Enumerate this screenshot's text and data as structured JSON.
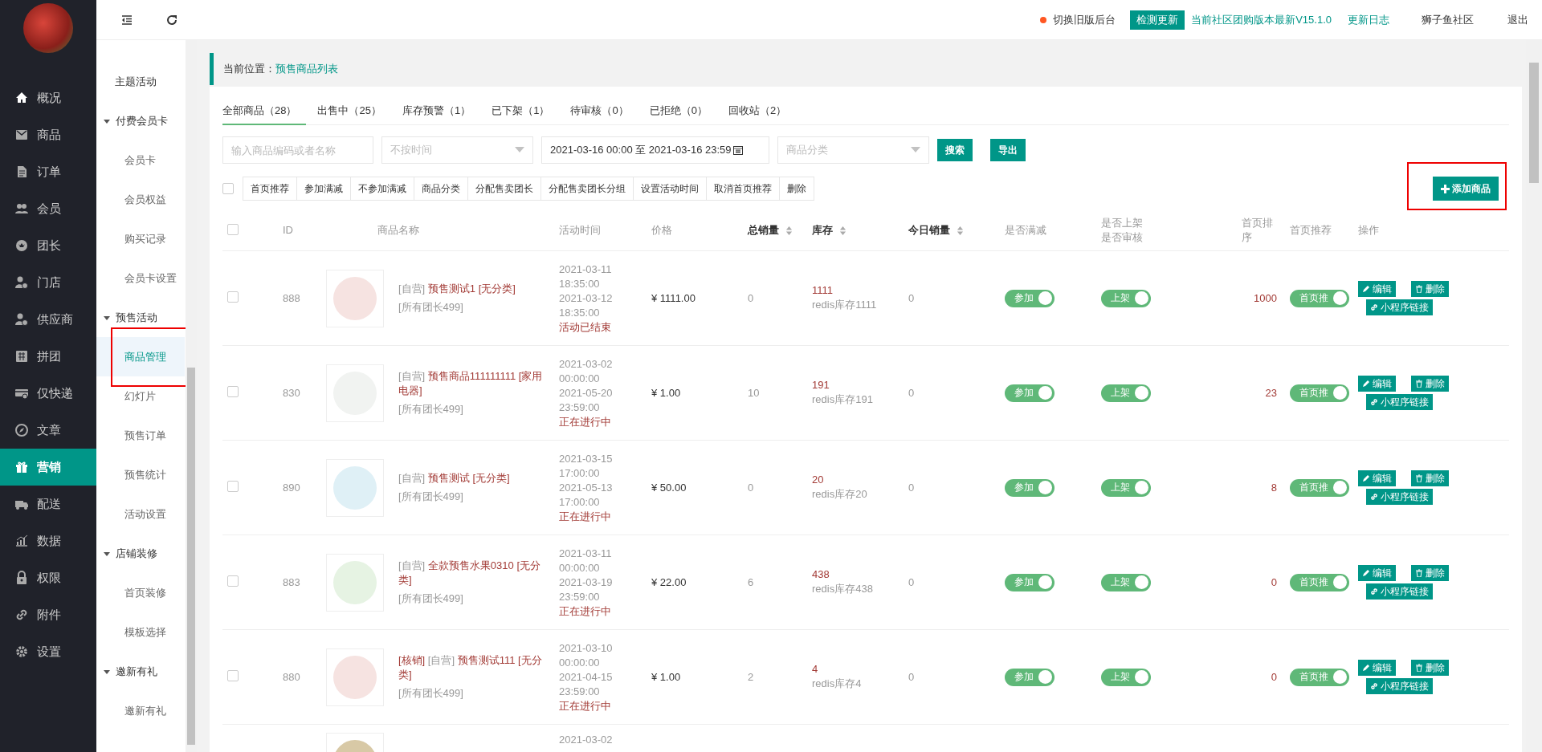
{
  "sidebar": {
    "items": [
      {
        "label": "概况",
        "selected": false
      },
      {
        "label": "商品",
        "selected": false
      },
      {
        "label": "订单",
        "selected": false
      },
      {
        "label": "会员",
        "selected": false
      },
      {
        "label": "团长",
        "selected": false
      },
      {
        "label": "门店",
        "selected": false
      },
      {
        "label": "供应商",
        "selected": false
      },
      {
        "label": "拼团",
        "selected": false
      },
      {
        "label": "仅快递",
        "selected": false
      },
      {
        "label": "文章",
        "selected": false
      },
      {
        "label": "营销",
        "selected": true
      },
      {
        "label": "配送",
        "selected": false
      },
      {
        "label": "数据",
        "selected": false
      },
      {
        "label": "权限",
        "selected": false
      },
      {
        "label": "附件",
        "selected": false
      },
      {
        "label": "设置",
        "selected": false
      }
    ]
  },
  "submenu": {
    "items": [
      {
        "kind": "link",
        "label": "主题活动",
        "selected": false,
        "highlighted": false
      },
      {
        "kind": "group",
        "label": "付费会员卡",
        "expanded": true,
        "children": [
          {
            "label": "会员卡",
            "selected": false,
            "highlighted": false
          },
          {
            "label": "会员权益",
            "selected": false,
            "highlighted": false
          },
          {
            "label": "购买记录",
            "selected": false,
            "highlighted": false
          },
          {
            "label": "会员卡设置",
            "selected": false,
            "highlighted": false
          }
        ]
      },
      {
        "kind": "group",
        "label": "预售活动",
        "expanded": true,
        "children": [
          {
            "label": "商品管理",
            "selected": true,
            "highlighted": true
          },
          {
            "label": "幻灯片",
            "selected": false,
            "highlighted": false
          },
          {
            "label": "预售订单",
            "selected": false,
            "highlighted": false
          },
          {
            "label": "预售统计",
            "selected": false,
            "highlighted": false
          },
          {
            "label": "活动设置",
            "selected": false,
            "highlighted": false
          }
        ]
      },
      {
        "kind": "group",
        "label": "店铺装修",
        "expanded": true,
        "children": [
          {
            "label": "首页装修",
            "selected": false,
            "highlighted": false
          },
          {
            "label": "模板选择",
            "selected": false,
            "highlighted": false
          }
        ]
      },
      {
        "kind": "group",
        "label": "邀新有礼",
        "expanded": true,
        "children": [
          {
            "label": "邀新有礼",
            "selected": false,
            "highlighted": false
          }
        ]
      }
    ]
  },
  "topbar": {
    "old_version": "切换旧版后台",
    "check_update": "检测更新",
    "version": "当前社区团购版本最新V15.1.0",
    "changelog": "更新日志",
    "community": "狮子鱼社区",
    "logout": "退出"
  },
  "breadcrumb": {
    "label": "当前位置：",
    "current": "预售商品列表"
  },
  "tabs": [
    {
      "label": "全部商品（28）",
      "selected": true
    },
    {
      "label": "出售中（25）",
      "selected": false
    },
    {
      "label": "库存预警（1）",
      "selected": false
    },
    {
      "label": "已下架（1）",
      "selected": false
    },
    {
      "label": "待审核（0）",
      "selected": false
    },
    {
      "label": "已拒绝（0）",
      "selected": false
    },
    {
      "label": "回收站（2）",
      "selected": false
    }
  ],
  "filters": {
    "keyword": {
      "placeholder": "输入商品编码或者名称"
    },
    "time_type": {
      "placeholder": "不按时间"
    },
    "date_range": {
      "value": "2021-03-16 00:00 至 2021-03-16 23:59"
    },
    "category": {
      "placeholder": "商品分类"
    },
    "buttons": [
      "搜索",
      "导出"
    ]
  },
  "batch_actions": {
    "select_all": false,
    "buttons": [
      "首页推荐",
      "参加满减",
      "不参加满减",
      "商品分类",
      "分配售卖团长",
      "分配售卖团长分组",
      "设置活动时间",
      "取消首页推荐",
      "删除"
    ]
  },
  "add_button": {
    "label": "添加商品",
    "highlighted": true
  },
  "table": {
    "select_all": false,
    "columns": [
      {
        "label": "ID",
        "sortable": false
      },
      {
        "label": "商品名称",
        "sortable": false
      },
      {
        "label": "活动时间",
        "sortable": false
      },
      {
        "label": "价格",
        "sortable": false
      },
      {
        "label": "总销量",
        "sortable": true
      },
      {
        "label": "库存",
        "sortable": true
      },
      {
        "label": "今日销量",
        "sortable": true
      },
      {
        "label": "是否满减",
        "sortable": false
      },
      {
        "label": "是否上架是否审核",
        "sortable": false
      },
      {
        "label": "首页排序",
        "sortable": false
      },
      {
        "label": "首页推荐",
        "sortable": false
      },
      {
        "label": "操作",
        "sortable": false
      }
    ],
    "rows": [
      {
        "kind": "full",
        "checked": false,
        "id": "888",
        "tags": [
          {
            "kind": "self",
            "text": "[自营]"
          }
        ],
        "name": "预售测试1 [无分类]",
        "leaders": "[所有团长499]",
        "start": "2021-03-11 18:35:00",
        "end": "2021-03-12 18:35:00",
        "status": "活动已结束",
        "price": "¥ 1111.00",
        "total_sales": "0",
        "stock": "1111",
        "redis_stock": "redis库存1111",
        "today_sales": "0",
        "full_reduction": {
          "label": "参加",
          "on": true
        },
        "on_shelf": {
          "label": "上架",
          "on": true
        },
        "rank": "1000",
        "recommend": {
          "label": "首页推",
          "on": true
        },
        "actions": [
          "编辑",
          "删除",
          "小程序链接"
        ]
      },
      {
        "kind": "full",
        "checked": false,
        "id": "830",
        "tags": [
          {
            "kind": "self",
            "text": "[自营]"
          }
        ],
        "name": "预售商品111111111 [家用电器]",
        "leaders": "[所有团长499]",
        "start": "2021-03-02 00:00:00",
        "end": "2021-05-20 23:59:00",
        "status": "正在进行中",
        "price": "¥ 1.00",
        "total_sales": "10",
        "stock": "191",
        "redis_stock": "redis库存191",
        "today_sales": "0",
        "full_reduction": {
          "label": "参加",
          "on": true
        },
        "on_shelf": {
          "label": "上架",
          "on": true
        },
        "rank": "23",
        "recommend": {
          "label": "首页推",
          "on": true
        },
        "actions": [
          "编辑",
          "删除",
          "小程序链接"
        ]
      },
      {
        "kind": "full",
        "checked": false,
        "id": "890",
        "tags": [
          {
            "kind": "self",
            "text": "[自营]"
          }
        ],
        "name": "预售测试 [无分类]",
        "leaders": "[所有团长499]",
        "start": "2021-03-15 17:00:00",
        "end": "2021-05-13 17:00:00",
        "status": "正在进行中",
        "price": "¥ 50.00",
        "total_sales": "0",
        "stock": "20",
        "redis_stock": "redis库存20",
        "today_sales": "0",
        "full_reduction": {
          "label": "参加",
          "on": true
        },
        "on_shelf": {
          "label": "上架",
          "on": true
        },
        "rank": "8",
        "recommend": {
          "label": "首页推",
          "on": true
        },
        "actions": [
          "编辑",
          "删除",
          "小程序链接"
        ]
      },
      {
        "kind": "full",
        "checked": false,
        "id": "883",
        "tags": [
          {
            "kind": "self",
            "text": "[自营]"
          }
        ],
        "name": "全款预售水果0310 [无分类]",
        "leaders": "[所有团长499]",
        "start": "2021-03-11 00:00:00",
        "end": "2021-03-19 23:59:00",
        "status": "正在进行中",
        "price": "¥ 22.00",
        "total_sales": "6",
        "stock": "438",
        "redis_stock": "redis库存438",
        "today_sales": "0",
        "full_reduction": {
          "label": "参加",
          "on": true
        },
        "on_shelf": {
          "label": "上架",
          "on": true
        },
        "rank": "0",
        "recommend": {
          "label": "首页推",
          "on": true
        },
        "actions": [
          "编辑",
          "删除",
          "小程序链接"
        ]
      },
      {
        "kind": "full",
        "checked": false,
        "id": "880",
        "tags": [
          {
            "kind": "verify",
            "text": "[核销]"
          },
          {
            "kind": "self",
            "text": "[自营]"
          }
        ],
        "name": "预售测试111 [无分类]",
        "leaders": "[所有团长499]",
        "start": "2021-03-10 00:00:00",
        "end": "2021-04-15 23:59:00",
        "status": "正在进行中",
        "price": "¥ 1.00",
        "total_sales": "2",
        "stock": "4",
        "redis_stock": "redis库存4",
        "today_sales": "0",
        "full_reduction": {
          "label": "参加",
          "on": true
        },
        "on_shelf": {
          "label": "上架",
          "on": true
        },
        "rank": "0",
        "recommend": {
          "label": "首页推",
          "on": true
        },
        "actions": [
          "编辑",
          "删除",
          "小程序链接"
        ]
      },
      {
        "kind": "partial",
        "start": "2021-03-02"
      }
    ]
  }
}
